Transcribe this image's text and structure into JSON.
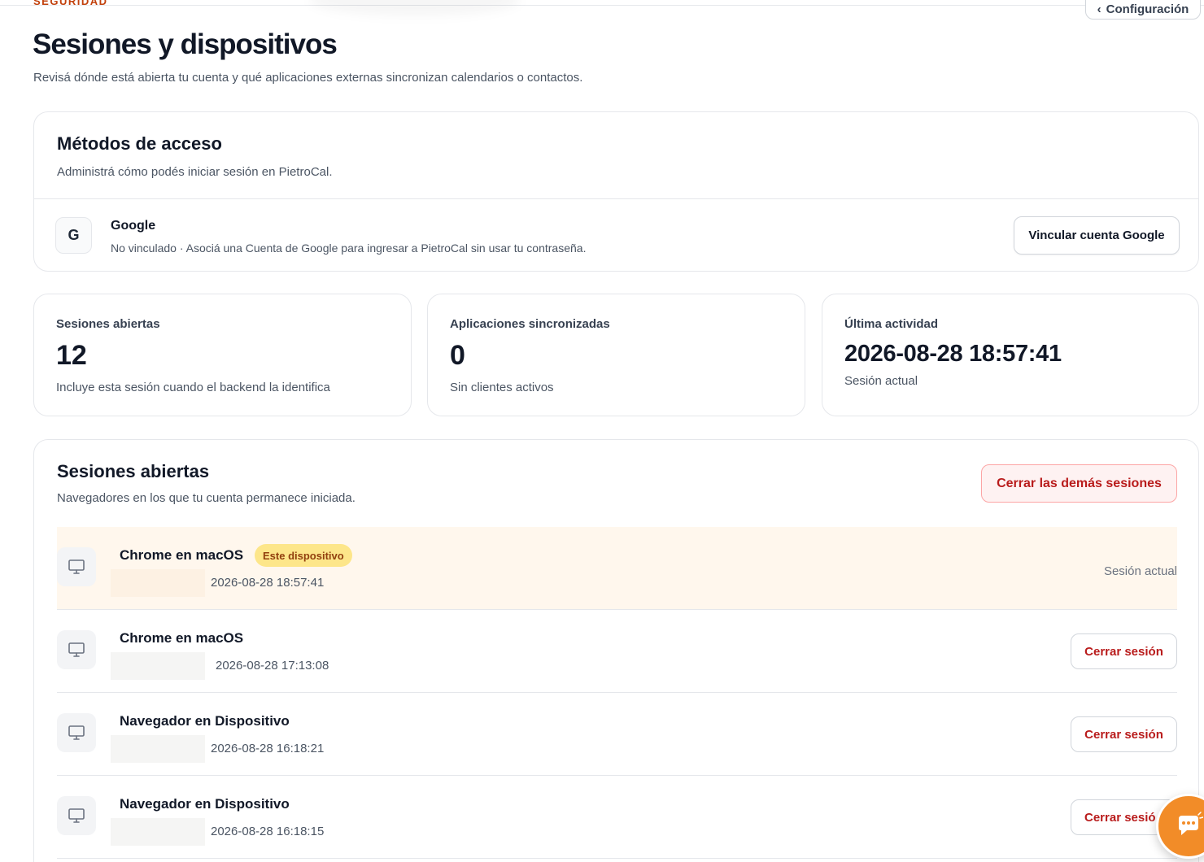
{
  "header": {
    "section_label": "SEGURIDAD",
    "config_button": "Configuración",
    "title": "Sesiones y dispositivos",
    "subtitle": "Revisá dónde está abierta tu cuenta y qué aplicaciones externas sincronizan calendarios o contactos."
  },
  "access_methods": {
    "title": "Métodos de acceso",
    "description": "Administrá cómo podés iniciar sesión en PietroCal.",
    "provider": {
      "icon_letter": "G",
      "name": "Google",
      "status": "No vinculado · Asociá una Cuenta de Google para ingresar a PietroCal sin usar tu contraseña.",
      "button": "Vincular cuenta Google"
    }
  },
  "stats": [
    {
      "label": "Sesiones abiertas",
      "value": "12",
      "note": "Incluye esta sesión cuando el backend la identifica"
    },
    {
      "label": "Aplicaciones sincronizadas",
      "value": "0",
      "note": "Sin clientes activos"
    },
    {
      "label": "Última actividad",
      "value": "2026-08-28 18:57:41",
      "note": "Sesión actual"
    }
  ],
  "sessions": {
    "title": "Sesiones abiertas",
    "description": "Navegadores en los que tu cuenta permanece iniciada.",
    "close_others_button": "Cerrar las demás sesiones",
    "current_badge": "Este dispositivo",
    "current_label": "Sesión actual",
    "close_button": "Cerrar sesión",
    "close_button_last": "Cerrar sesió",
    "items": [
      {
        "name": "Chrome en macOS",
        "time": "2026-08-28 18:57:41",
        "current": true
      },
      {
        "name": "Chrome en macOS",
        "time": "2026-08-28 17:13:08",
        "current": false
      },
      {
        "name": "Navegador en Dispositivo",
        "time": "2026-08-28 16:18:21",
        "current": false
      },
      {
        "name": "Navegador en Dispositivo",
        "time": "2026-08-28 16:18:15",
        "current": false
      }
    ]
  },
  "icons": {
    "device": "monitor-icon",
    "chat": "chat-bubble-icon",
    "back": "chevron-left-icon"
  },
  "colors": {
    "accent": "#c2410c",
    "danger": "#b91c1c",
    "current_row_bg": "#fff7ed",
    "badge_bg": "#fde68a",
    "chat_fab": "#f28c28"
  }
}
